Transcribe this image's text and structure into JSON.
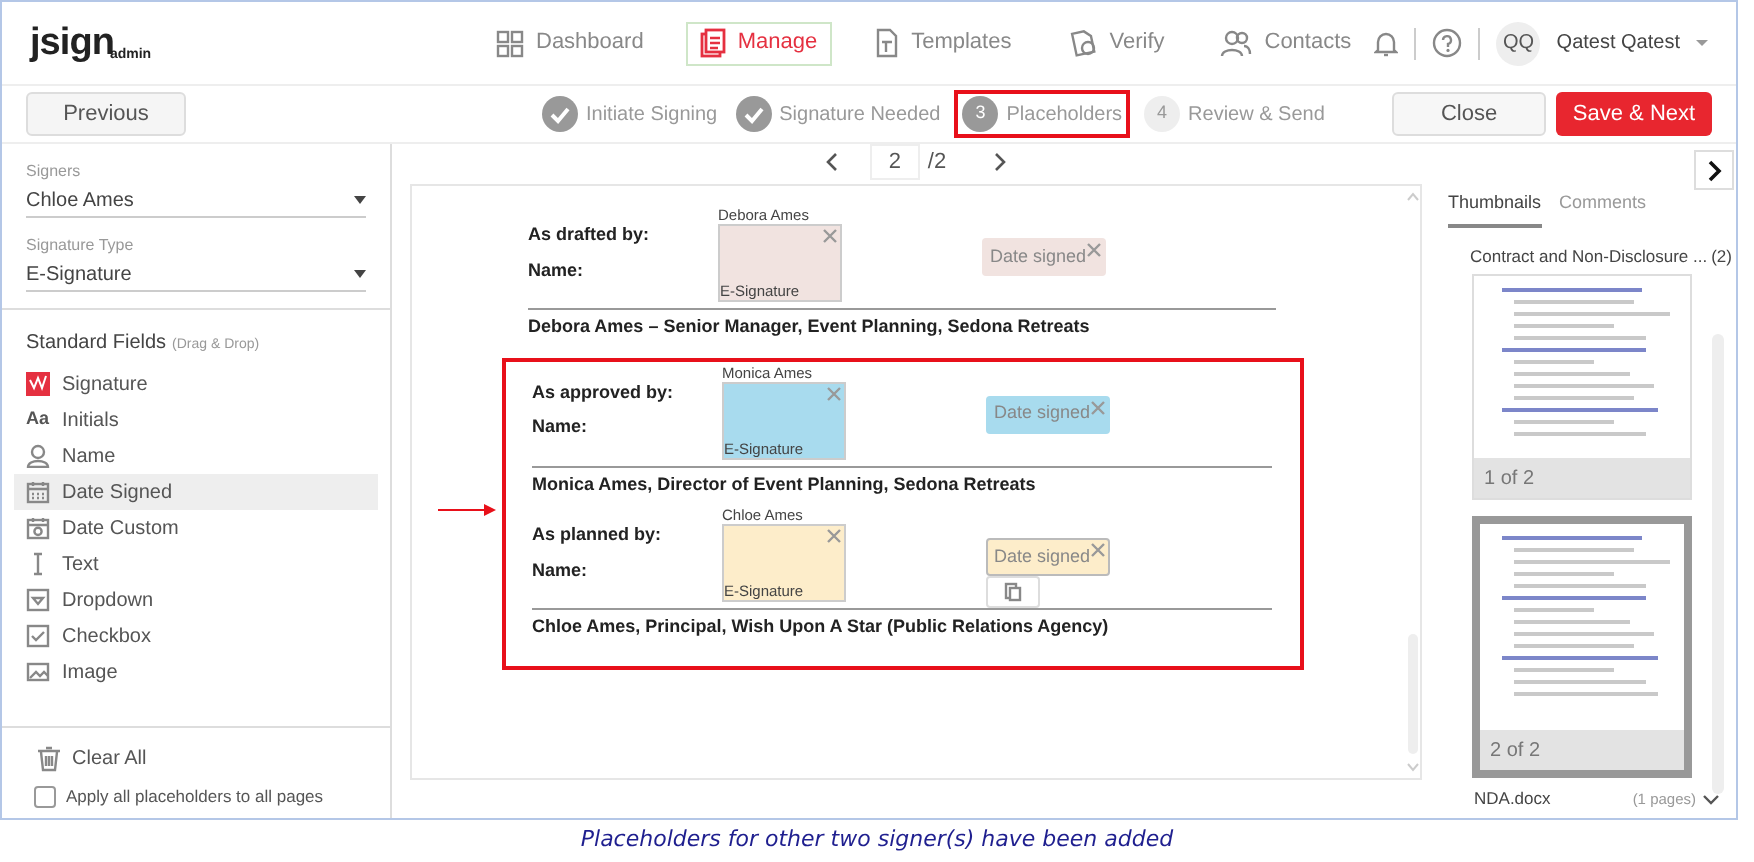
{
  "app": {
    "logo": "jsign",
    "logo_sub": "admin"
  },
  "nav": [
    {
      "label": "Dashboard",
      "kind": "grid",
      "selected": false
    },
    {
      "label": "Manage",
      "kind": "document",
      "selected": true
    },
    {
      "label": "Templates",
      "kind": "template",
      "selected": false
    },
    {
      "label": "Verify",
      "kind": "verify",
      "selected": false
    },
    {
      "label": "Contacts",
      "kind": "contacts",
      "selected": false
    }
  ],
  "user": {
    "initials": "QQ",
    "name": "Qatest Qatest"
  },
  "toolbar": {
    "previous": "Previous",
    "close": "Close",
    "save": "Save & Next"
  },
  "steps": [
    {
      "label": "Initiate Signing",
      "done": true,
      "selected": false
    },
    {
      "label": "Signature Needed",
      "done": true,
      "selected": false
    },
    {
      "number": "3",
      "label": "Placeholders",
      "done": false,
      "selected": true
    },
    {
      "number": "4",
      "label": "Review & Send",
      "done": false,
      "selected": false
    }
  ],
  "sidebar": {
    "signers": {
      "label": "Signers",
      "value": "Chloe Ames"
    },
    "signature_type": {
      "label": "Signature Type",
      "value": "E-Signature"
    },
    "fields_title": "Standard Fields",
    "fields_hint": "(Drag & Drop)",
    "fields": [
      {
        "label": "Signature",
        "kind": "signature",
        "selected": false
      },
      {
        "label": "Initials",
        "kind": "initials",
        "glyph": "Aa",
        "selected": false
      },
      {
        "label": "Name",
        "kind": "person",
        "selected": false
      },
      {
        "label": "Date Signed",
        "kind": "calendar",
        "selected": true
      },
      {
        "label": "Date Custom",
        "kind": "calendar-custom",
        "selected": false
      },
      {
        "label": "Text",
        "kind": "text-cursor",
        "selected": false
      },
      {
        "label": "Dropdown",
        "kind": "dropdown",
        "selected": false
      },
      {
        "label": "Checkbox",
        "kind": "checkbox",
        "selected": false
      },
      {
        "label": "Image",
        "kind": "image",
        "selected": false
      }
    ],
    "clear_all": "Clear All",
    "apply_all": {
      "label": "Apply all placeholders to all pages",
      "checked": false
    }
  },
  "pager": {
    "page": "2",
    "total": "/2"
  },
  "document": {
    "blocks": [
      {
        "role": "As drafted by:",
        "name_label": "Name:",
        "signer": "Debora Ames",
        "signature_type": "E-Signature",
        "date_placeholder": "Date signed",
        "footer": "Debora Ames – Senior Manager, Event Planning, Sedona Retreats",
        "color": "#f1e3e0",
        "highlighted": false,
        "selected": false
      },
      {
        "role": "As approved by:",
        "name_label": "Name:",
        "signer": "Monica Ames",
        "signature_type": "E-Signature",
        "date_placeholder": "Date signed",
        "footer": "Monica Ames, Director of Event Planning, Sedona Retreats",
        "color": "#a8dbee",
        "highlighted": true,
        "selected": false
      },
      {
        "role": "As planned by:",
        "name_label": "Name:",
        "signer": "Chloe Ames",
        "signature_type": "E-Signature",
        "date_placeholder": "Date signed",
        "footer": "Chloe Ames, Principal, Wish Upon A Star (Public Relations Agency)",
        "color": "#fdedca",
        "highlighted": true,
        "selected": true
      }
    ]
  },
  "thumbnails": {
    "tabs": [
      {
        "label": "Thumbnails",
        "selected": true
      },
      {
        "label": "Comments",
        "selected": false
      }
    ],
    "document_name": "Contract and Non-Disclosure ...",
    "document_count": "(2)",
    "pages": [
      {
        "label": "1 of 2",
        "selected": false
      },
      {
        "label": "2 of 2",
        "selected": true
      }
    ],
    "next_document": "NDA.docx",
    "next_document_pages": "(1 pages)"
  },
  "caption": "Placeholders for other two signer(s) have been added"
}
